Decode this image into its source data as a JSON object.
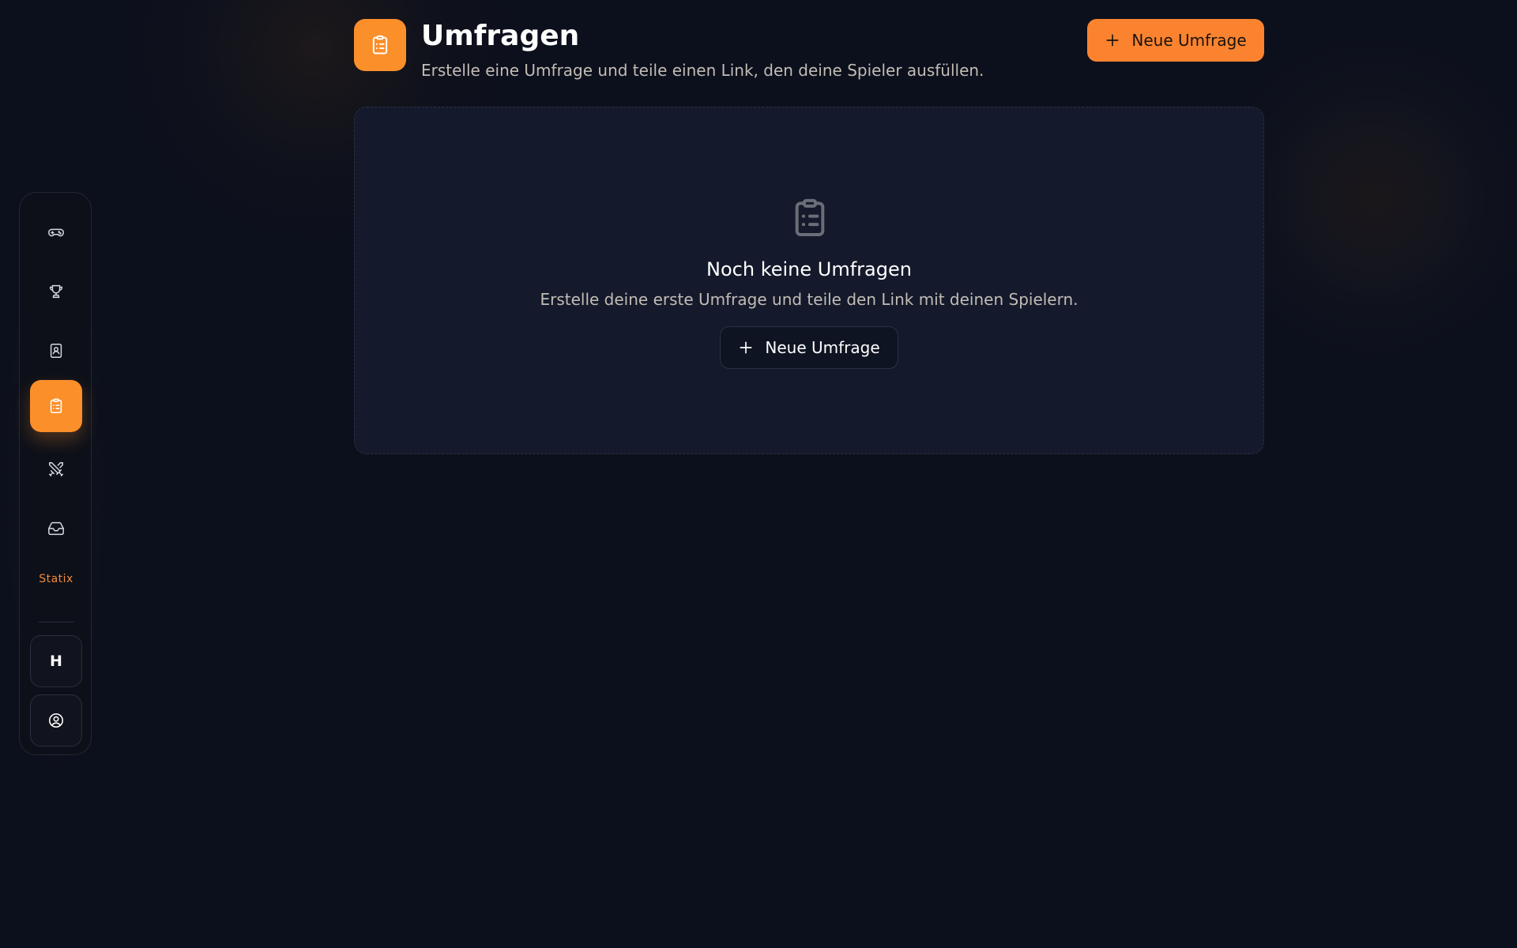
{
  "header": {
    "title": "Umfragen",
    "subtitle": "Erstelle eine Umfrage und teile einen Link, den deine Spieler ausfüllen.",
    "new_survey_label": "Neue Umfrage",
    "icon": "clipboard-list-icon"
  },
  "empty_state": {
    "icon": "clipboard-list-icon",
    "title": "Noch keine Umfragen",
    "text": "Erstelle deine erste Umfrage und teile den Link mit deinen Spielern.",
    "button_label": "Neue Umfrage"
  },
  "sidebar": {
    "items": [
      {
        "icon": "gamepad-icon",
        "active": false
      },
      {
        "icon": "trophy-icon",
        "active": false
      },
      {
        "icon": "contact-book-icon",
        "active": false
      },
      {
        "icon": "clipboard-list-icon",
        "active": true
      },
      {
        "icon": "crossed-swords-icon",
        "active": false
      },
      {
        "icon": "inbox-tray-icon",
        "active": false
      }
    ],
    "logo_text": "Statix",
    "workspace_letter": "H",
    "profile_icon": "user-circle-icon"
  },
  "colors": {
    "background": "#0c101c",
    "accent": "#fb8f2a",
    "card": "#141a2b",
    "muted_text": "#c3bcb6"
  }
}
